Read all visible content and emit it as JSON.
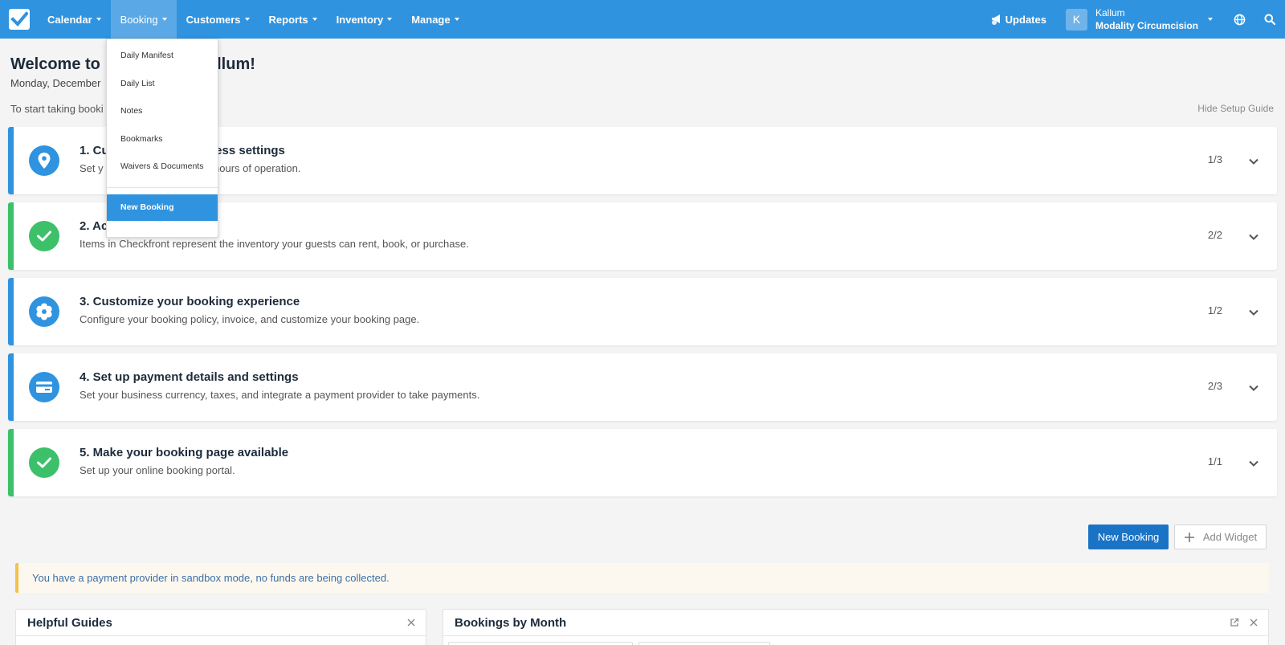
{
  "nav": {
    "items": [
      {
        "label": "Calendar"
      },
      {
        "label": "Booking"
      },
      {
        "label": "Customers"
      },
      {
        "label": "Reports"
      },
      {
        "label": "Inventory"
      },
      {
        "label": "Manage"
      }
    ],
    "updates_label": "Updates",
    "user_initial": "K",
    "user_name": "Kallum",
    "user_company": "Modality Circumcision"
  },
  "booking_menu": {
    "items": [
      {
        "label": "Daily Manifest"
      },
      {
        "label": "Daily List"
      },
      {
        "label": "Notes"
      },
      {
        "label": "Bookmarks"
      },
      {
        "label": "Waivers & Documents"
      }
    ],
    "new_booking": "New Booking"
  },
  "welcome": {
    "title_visible_start": "Welcome to",
    "title_visible_end": "allum!",
    "date_visible": "Monday, December",
    "intro_visible": "To start taking booki",
    "hide_guide": "Hide Setup Guide"
  },
  "steps": [
    {
      "title": "1. Cu",
      "title_tail": "ness settings",
      "desc": "Set y",
      "desc_tail": "hours of operation.",
      "count": "1/3",
      "icon": "location-pin-icon",
      "status": "in-progress"
    },
    {
      "title": "2. Ac",
      "desc": "Items in Checkfront represent the inventory your guests can rent, book, or purchase.",
      "count": "2/2",
      "icon": "check-icon",
      "status": "done"
    },
    {
      "title": "3. Customize your booking experience",
      "desc": "Configure your booking policy, invoice, and customize your booking page.",
      "count": "1/2",
      "icon": "gear-icon",
      "status": "in-progress"
    },
    {
      "title": "4. Set up payment details and settings",
      "desc": "Set your business currency, taxes, and integrate a payment provider to take payments.",
      "count": "2/3",
      "icon": "credit-card-icon",
      "status": "in-progress"
    },
    {
      "title": "5. Make your booking page available",
      "desc": "Set up your online booking portal.",
      "count": "1/1",
      "icon": "check-icon",
      "status": "done"
    }
  ],
  "actions": {
    "new_booking": "New Booking",
    "add_widget": "Add Widget"
  },
  "alert": {
    "text": "You have a payment provider in sandbox mode, no funds are being collected."
  },
  "widgets": {
    "helpful_guides": "Helpful Guides",
    "bookings_by_month": "Bookings by Month"
  },
  "colors": {
    "primary": "#2f93df",
    "done": "#3cc06a",
    "button": "#1a73c5",
    "alert_border": "#f3c24c"
  }
}
